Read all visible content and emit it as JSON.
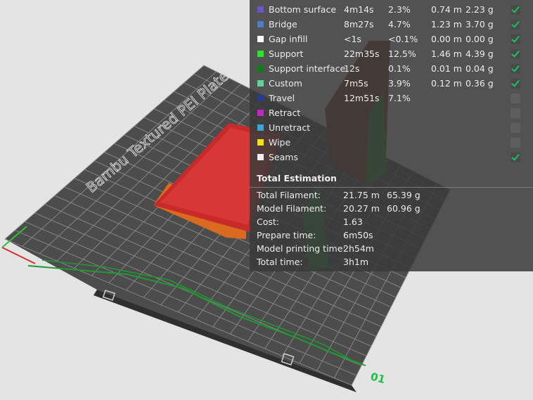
{
  "legend": {
    "rows": [
      {
        "color": "#6b54c8",
        "label": "Bottom surface",
        "time": "4m14s",
        "percent": "2.3%",
        "length": "0.74 m",
        "weight": "2.23 g",
        "checked": true
      },
      {
        "color": "#4d7cc8",
        "label": "Bridge",
        "time": "8m27s",
        "percent": "4.7%",
        "length": "1.23 m",
        "weight": "3.70 g",
        "checked": true
      },
      {
        "color": "#ffffff",
        "label": "Gap infill",
        "time": "<1s",
        "percent": "<0.1%",
        "length": "0.00 m",
        "weight": "0.00 g",
        "checked": true
      },
      {
        "color": "#29e627",
        "label": "Support",
        "time": "22m35s",
        "percent": "12.5%",
        "length": "1.46 m",
        "weight": "4.39 g",
        "checked": true
      },
      {
        "color": "#0a7d16",
        "label": "Support interface",
        "time": "12s",
        "percent": "0.1%",
        "length": "0.01 m",
        "weight": "0.04 g",
        "checked": true
      },
      {
        "color": "#5fd49a",
        "label": "Custom",
        "time": "7m5s",
        "percent": "3.9%",
        "length": "0.12 m",
        "weight": "0.36 g",
        "checked": true
      },
      {
        "color": "#2b3a9a",
        "label": "Travel",
        "time": "12m51s",
        "percent": "7.1%",
        "length": "",
        "weight": "",
        "checked": false
      },
      {
        "color": "#c428c4",
        "label": "Retract",
        "time": "",
        "percent": "",
        "length": "",
        "weight": "",
        "checked": false
      },
      {
        "color": "#3aa6d6",
        "label": "Unretract",
        "time": "",
        "percent": "",
        "length": "",
        "weight": "",
        "checked": false
      },
      {
        "color": "#f2e210",
        "label": "Wipe",
        "time": "",
        "percent": "",
        "length": "",
        "weight": "",
        "checked": false
      },
      {
        "color": "#f0f0f0",
        "label": "Seams",
        "time": "",
        "percent": "",
        "length": "",
        "weight": "",
        "checked": true
      }
    ]
  },
  "estimation": {
    "title": "Total Estimation",
    "rows": [
      {
        "label": "Total Filament:",
        "value": "21.75 m",
        "value2": "65.39 g"
      },
      {
        "label": "Model Filament:",
        "value": "20.27 m",
        "value2": "60.96 g"
      },
      {
        "label": "Cost:",
        "value": "1.63",
        "value2": ""
      },
      {
        "label": "Prepare time:",
        "value": "6m50s",
        "value2": ""
      },
      {
        "label": "Model printing time:",
        "value": "2h54m",
        "value2": ""
      },
      {
        "label": "Total time:",
        "value": "3h1m",
        "value2": ""
      }
    ]
  },
  "plate": {
    "brand_text": "Bambu Textured PEI Plate",
    "plate_number": "01"
  },
  "colors": {
    "plate": "#4a4a4a",
    "grid": "#8a8a8a",
    "model_red": "#d42f2f",
    "model_orange": "#e0701f",
    "tower_brown": "#7a3a24",
    "support_green": "#1f9a2f",
    "panel_bg": "#3a3a3a",
    "check_green": "#17c35a"
  }
}
